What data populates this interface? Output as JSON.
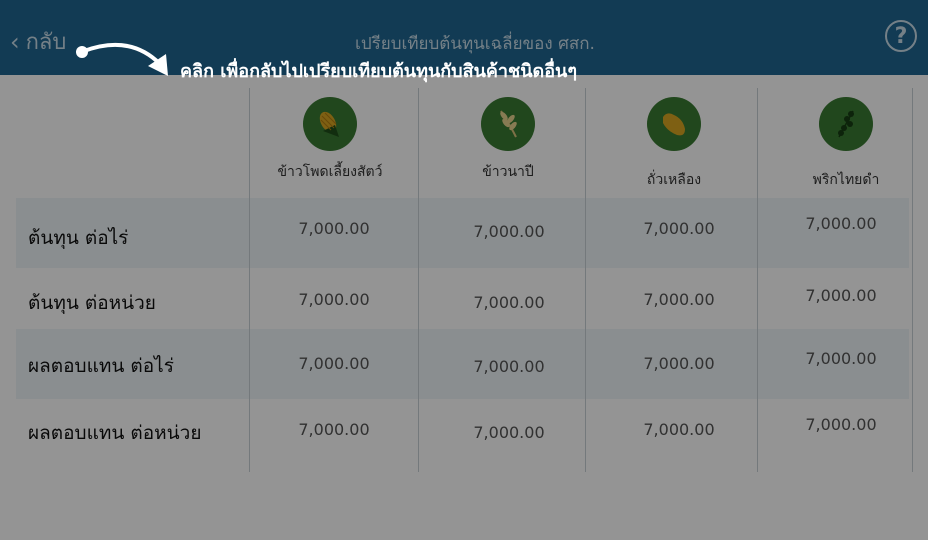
{
  "header": {
    "back_label": "กลับ",
    "title": "เปรียบเทียบต้นทุนเฉลี่ยของ ศสก.",
    "help_label": "?"
  },
  "hint": {
    "text": "คลิก เพื่อกลับไปเปรียบเทียบต้นทุนกับสินค้าชนิดอื่นๆ",
    "arrow_icon": "curved-arrow-icon"
  },
  "columns": [
    {
      "name": "ข้าวโพดเลี้ยงสัตว์",
      "icon": "corn-icon"
    },
    {
      "name": "ข้าวนาปี",
      "icon": "rice-icon"
    },
    {
      "name": "ถั่วเหลือง",
      "icon": "soybean-icon"
    },
    {
      "name": "พริกไทยดำ",
      "icon": "pepper-icon"
    }
  ],
  "rows": [
    {
      "label": "ต้นทุน ต่อไร่",
      "values": [
        "7,000.00",
        "7,000.00",
        "7,000.00",
        "7,000.00"
      ]
    },
    {
      "label": "ต้นทุน ต่อหน่วย",
      "values": [
        "7,000.00",
        "7,000.00",
        "7,000.00",
        "7,000.00"
      ]
    },
    {
      "label": "ผลตอบแทน ต่อไร่",
      "values": [
        "7,000.00",
        "7,000.00",
        "7,000.00",
        "7,000.00"
      ]
    },
    {
      "label": "ผลตอบแทน ต่อหน่วย",
      "values": [
        "7,000.00",
        "7,000.00",
        "7,000.00",
        "7,000.00"
      ]
    }
  ],
  "colors": {
    "header": "#1f6691",
    "icon_circle": "#3a7a32",
    "row_band": "#eef5f9"
  }
}
